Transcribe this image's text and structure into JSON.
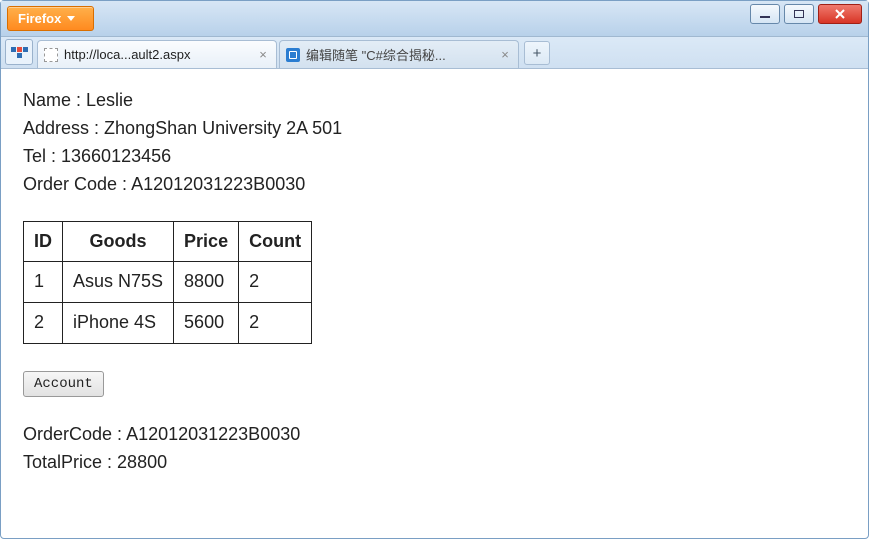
{
  "browser": {
    "menu_label": "Firefox",
    "tabs": [
      {
        "title": "http://loca...ault2.aspx"
      },
      {
        "title": "编辑随笔 \"C#综合揭秘..."
      }
    ],
    "newtab_label": "+"
  },
  "page": {
    "info": {
      "name_label": "Name : ",
      "name_value": "Leslie",
      "address_label": "Address : ",
      "address_value": "ZhongShan University 2A 501",
      "tel_label": "Tel : ",
      "tel_value": "13660123456",
      "ordercode_label": "Order Code : ",
      "ordercode_value": "A12012031223B0030"
    },
    "table": {
      "headers": {
        "id": "ID",
        "goods": "Goods",
        "price": "Price",
        "count": "Count"
      },
      "rows": [
        {
          "id": "1",
          "goods": "Asus N75S",
          "price": "8800",
          "count": "2"
        },
        {
          "id": "2",
          "goods": "iPhone 4S",
          "price": "5600",
          "count": "2"
        }
      ]
    },
    "account_button": "Account",
    "result": {
      "ordercode_label": "OrderCode  :  ",
      "ordercode_value": "A12012031223B0030",
      "totalprice_label": "TotalPrice : ",
      "totalprice_value": "28800"
    }
  }
}
